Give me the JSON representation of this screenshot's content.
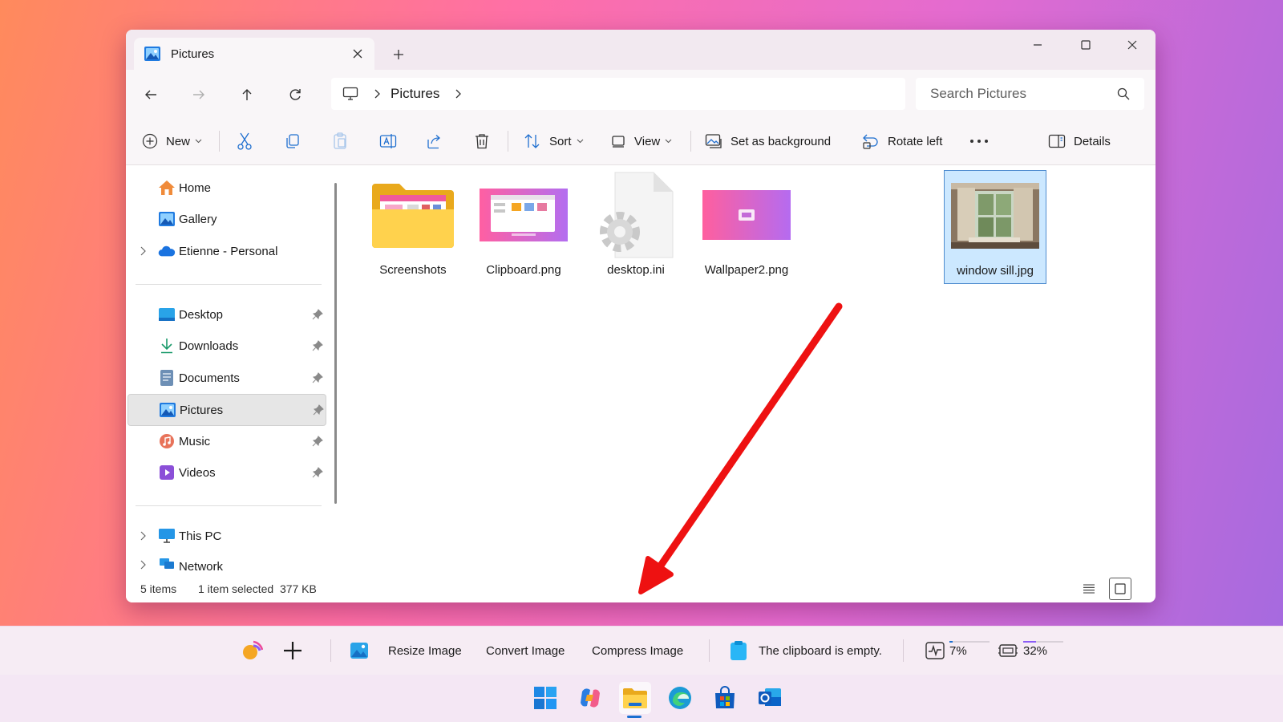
{
  "window": {
    "tab_title": "Pictures",
    "breadcrumb": "Pictures",
    "search_placeholder": "Search Pictures"
  },
  "commands": {
    "new": "New",
    "sort": "Sort",
    "view": "View",
    "set_background": "Set as background",
    "rotate_left": "Rotate left",
    "details": "Details"
  },
  "sidebar": {
    "home": "Home",
    "gallery": "Gallery",
    "onedrive": "Etienne - Personal",
    "desktop": "Desktop",
    "downloads": "Downloads",
    "documents": "Documents",
    "pictures": "Pictures",
    "music": "Music",
    "videos": "Videos",
    "thispc": "This PC",
    "network": "Network"
  },
  "files": [
    {
      "name": "Screenshots",
      "kind": "folder"
    },
    {
      "name": "Clipboard.png",
      "kind": "image"
    },
    {
      "name": "desktop.ini",
      "kind": "settings"
    },
    {
      "name": "Wallpaper2.png",
      "kind": "image"
    },
    {
      "name": "window sill.jpg",
      "kind": "photo",
      "selected": true
    }
  ],
  "status": {
    "count": "5 items",
    "selection": "1 item selected  377 KB"
  },
  "toolbar": {
    "resize": "Resize Image",
    "convert": "Convert Image",
    "compress": "Compress Image",
    "clipboard": "The clipboard is empty.",
    "cpu": "7%",
    "memory": "32%"
  },
  "taskbar": [
    "start-icon",
    "copilot-icon",
    "file-explorer-icon",
    "edge-icon",
    "store-icon",
    "outlook-icon"
  ],
  "colors": {
    "accent": "#0067c0",
    "selection": "#cce8ff",
    "annotation_arrow": "#ee1111"
  }
}
